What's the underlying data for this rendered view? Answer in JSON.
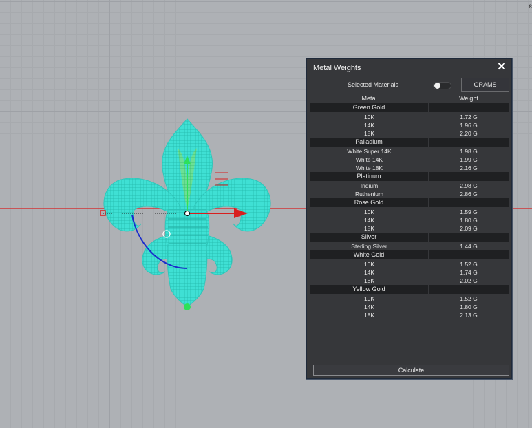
{
  "panel": {
    "title": "Metal Weights",
    "selected_materials_label": "Selected Materials",
    "selected_materials_on": false,
    "unit_label": "GRAMS",
    "col_metal": "Metal",
    "col_weight": "Weight",
    "calculate_label": "Calculate",
    "groups": [
      {
        "name": "Green Gold",
        "rows": [
          {
            "metal": "10K",
            "weight": "1.72 G"
          },
          {
            "metal": "14K",
            "weight": "1.96 G"
          },
          {
            "metal": "18K",
            "weight": "2.20 G"
          }
        ]
      },
      {
        "name": "Palladium",
        "rows": [
          {
            "metal": "White Super 14K",
            "weight": "1.98 G"
          },
          {
            "metal": "White 14K",
            "weight": "1.99 G"
          },
          {
            "metal": "White 18K",
            "weight": "2.16 G"
          }
        ]
      },
      {
        "name": "Platinum",
        "rows": [
          {
            "metal": "Iridium",
            "weight": "2.98 G"
          },
          {
            "metal": "Ruthenium",
            "weight": "2.86 G"
          }
        ]
      },
      {
        "name": "Rose Gold",
        "rows": [
          {
            "metal": "10K",
            "weight": "1.59 G"
          },
          {
            "metal": "14K",
            "weight": "1.80 G"
          },
          {
            "metal": "18K",
            "weight": "2.09 G"
          }
        ]
      },
      {
        "name": "Silver",
        "rows": [
          {
            "metal": "Sterling Silver",
            "weight": "1.44 G"
          }
        ]
      },
      {
        "name": "White Gold",
        "rows": [
          {
            "metal": "10K",
            "weight": "1.52 G"
          },
          {
            "metal": "14K",
            "weight": "1.74 G"
          },
          {
            "metal": "18K",
            "weight": "2.02 G"
          }
        ]
      },
      {
        "name": "Yellow Gold",
        "rows": [
          {
            "metal": "10K",
            "weight": "1.52 G"
          },
          {
            "metal": "14K",
            "weight": "1.80 G"
          },
          {
            "metal": "18K",
            "weight": "2.13 G"
          }
        ]
      }
    ]
  },
  "viewport": {
    "model_color": "#3fe0d4",
    "x_axis_color": "#d81e1e",
    "gumball_rotate_color": "#1a2ccc",
    "gumball_y_color": "#2ee05a"
  }
}
